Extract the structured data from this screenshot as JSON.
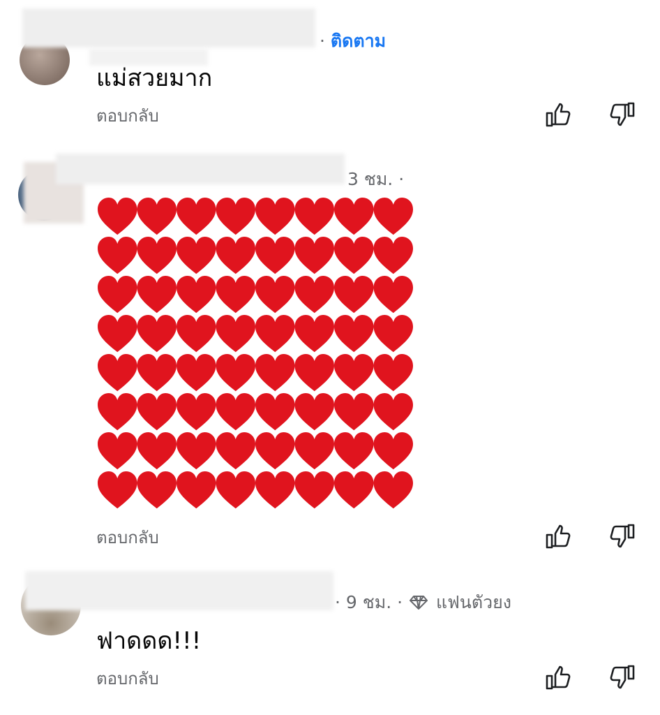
{
  "comments": [
    {
      "author_hidden": true,
      "meta_separator": "·",
      "follow_label": "ติดตาม",
      "text": "แม่สวยมาก",
      "reply_label": "ตอบกลับ"
    },
    {
      "author_hidden": true,
      "time": "3 ชม. ·",
      "sticker": {
        "type": "heart-grid",
        "rows": 8,
        "cols": 8,
        "color": "#e0141e"
      },
      "reply_label": "ตอบกลับ"
    },
    {
      "author_hidden": true,
      "time": "· 9 ชม. ·",
      "badge_icon": "diamond-icon",
      "badge_label": "แฟนตัวยง",
      "text": "ฟาดดด!!!",
      "reply_label": "ตอบกลับ"
    }
  ],
  "icons": {
    "like": "thumbs-up-icon",
    "dislike": "thumbs-down-icon"
  },
  "colors": {
    "link": "#1877f2",
    "secondary": "#65676b",
    "heart": "#e0141e"
  }
}
